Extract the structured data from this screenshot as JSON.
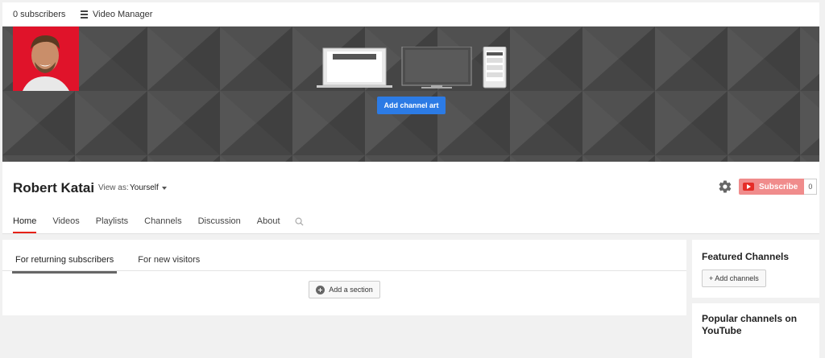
{
  "topbar": {
    "subscribers": "0 subscribers",
    "video_manager": "Video Manager"
  },
  "banner": {
    "add_art_label": "Add channel art"
  },
  "channel": {
    "name": "Robert Katai",
    "view_as_label": "View as:",
    "view_as_value": "Yourself",
    "subscribe_label": "Subscribe",
    "subscribe_count": "0"
  },
  "tabs": [
    {
      "label": "Home",
      "active": true
    },
    {
      "label": "Videos"
    },
    {
      "label": "Playlists"
    },
    {
      "label": "Channels"
    },
    {
      "label": "Discussion"
    },
    {
      "label": "About"
    }
  ],
  "main": {
    "subtabs": [
      {
        "label": "For returning subscribers",
        "active": true
      },
      {
        "label": "For new visitors"
      }
    ],
    "add_section_label": "Add a section"
  },
  "sidebar": {
    "featured_title": "Featured Channels",
    "add_channels_label": "+ Add channels",
    "popular_title": "Popular channels on YouTube"
  },
  "colors": {
    "accent_red": "#e62117",
    "button_blue": "#2c7be5",
    "subscribe_pink": "#f08c8c",
    "banner_gray": "#4a4a4a"
  }
}
